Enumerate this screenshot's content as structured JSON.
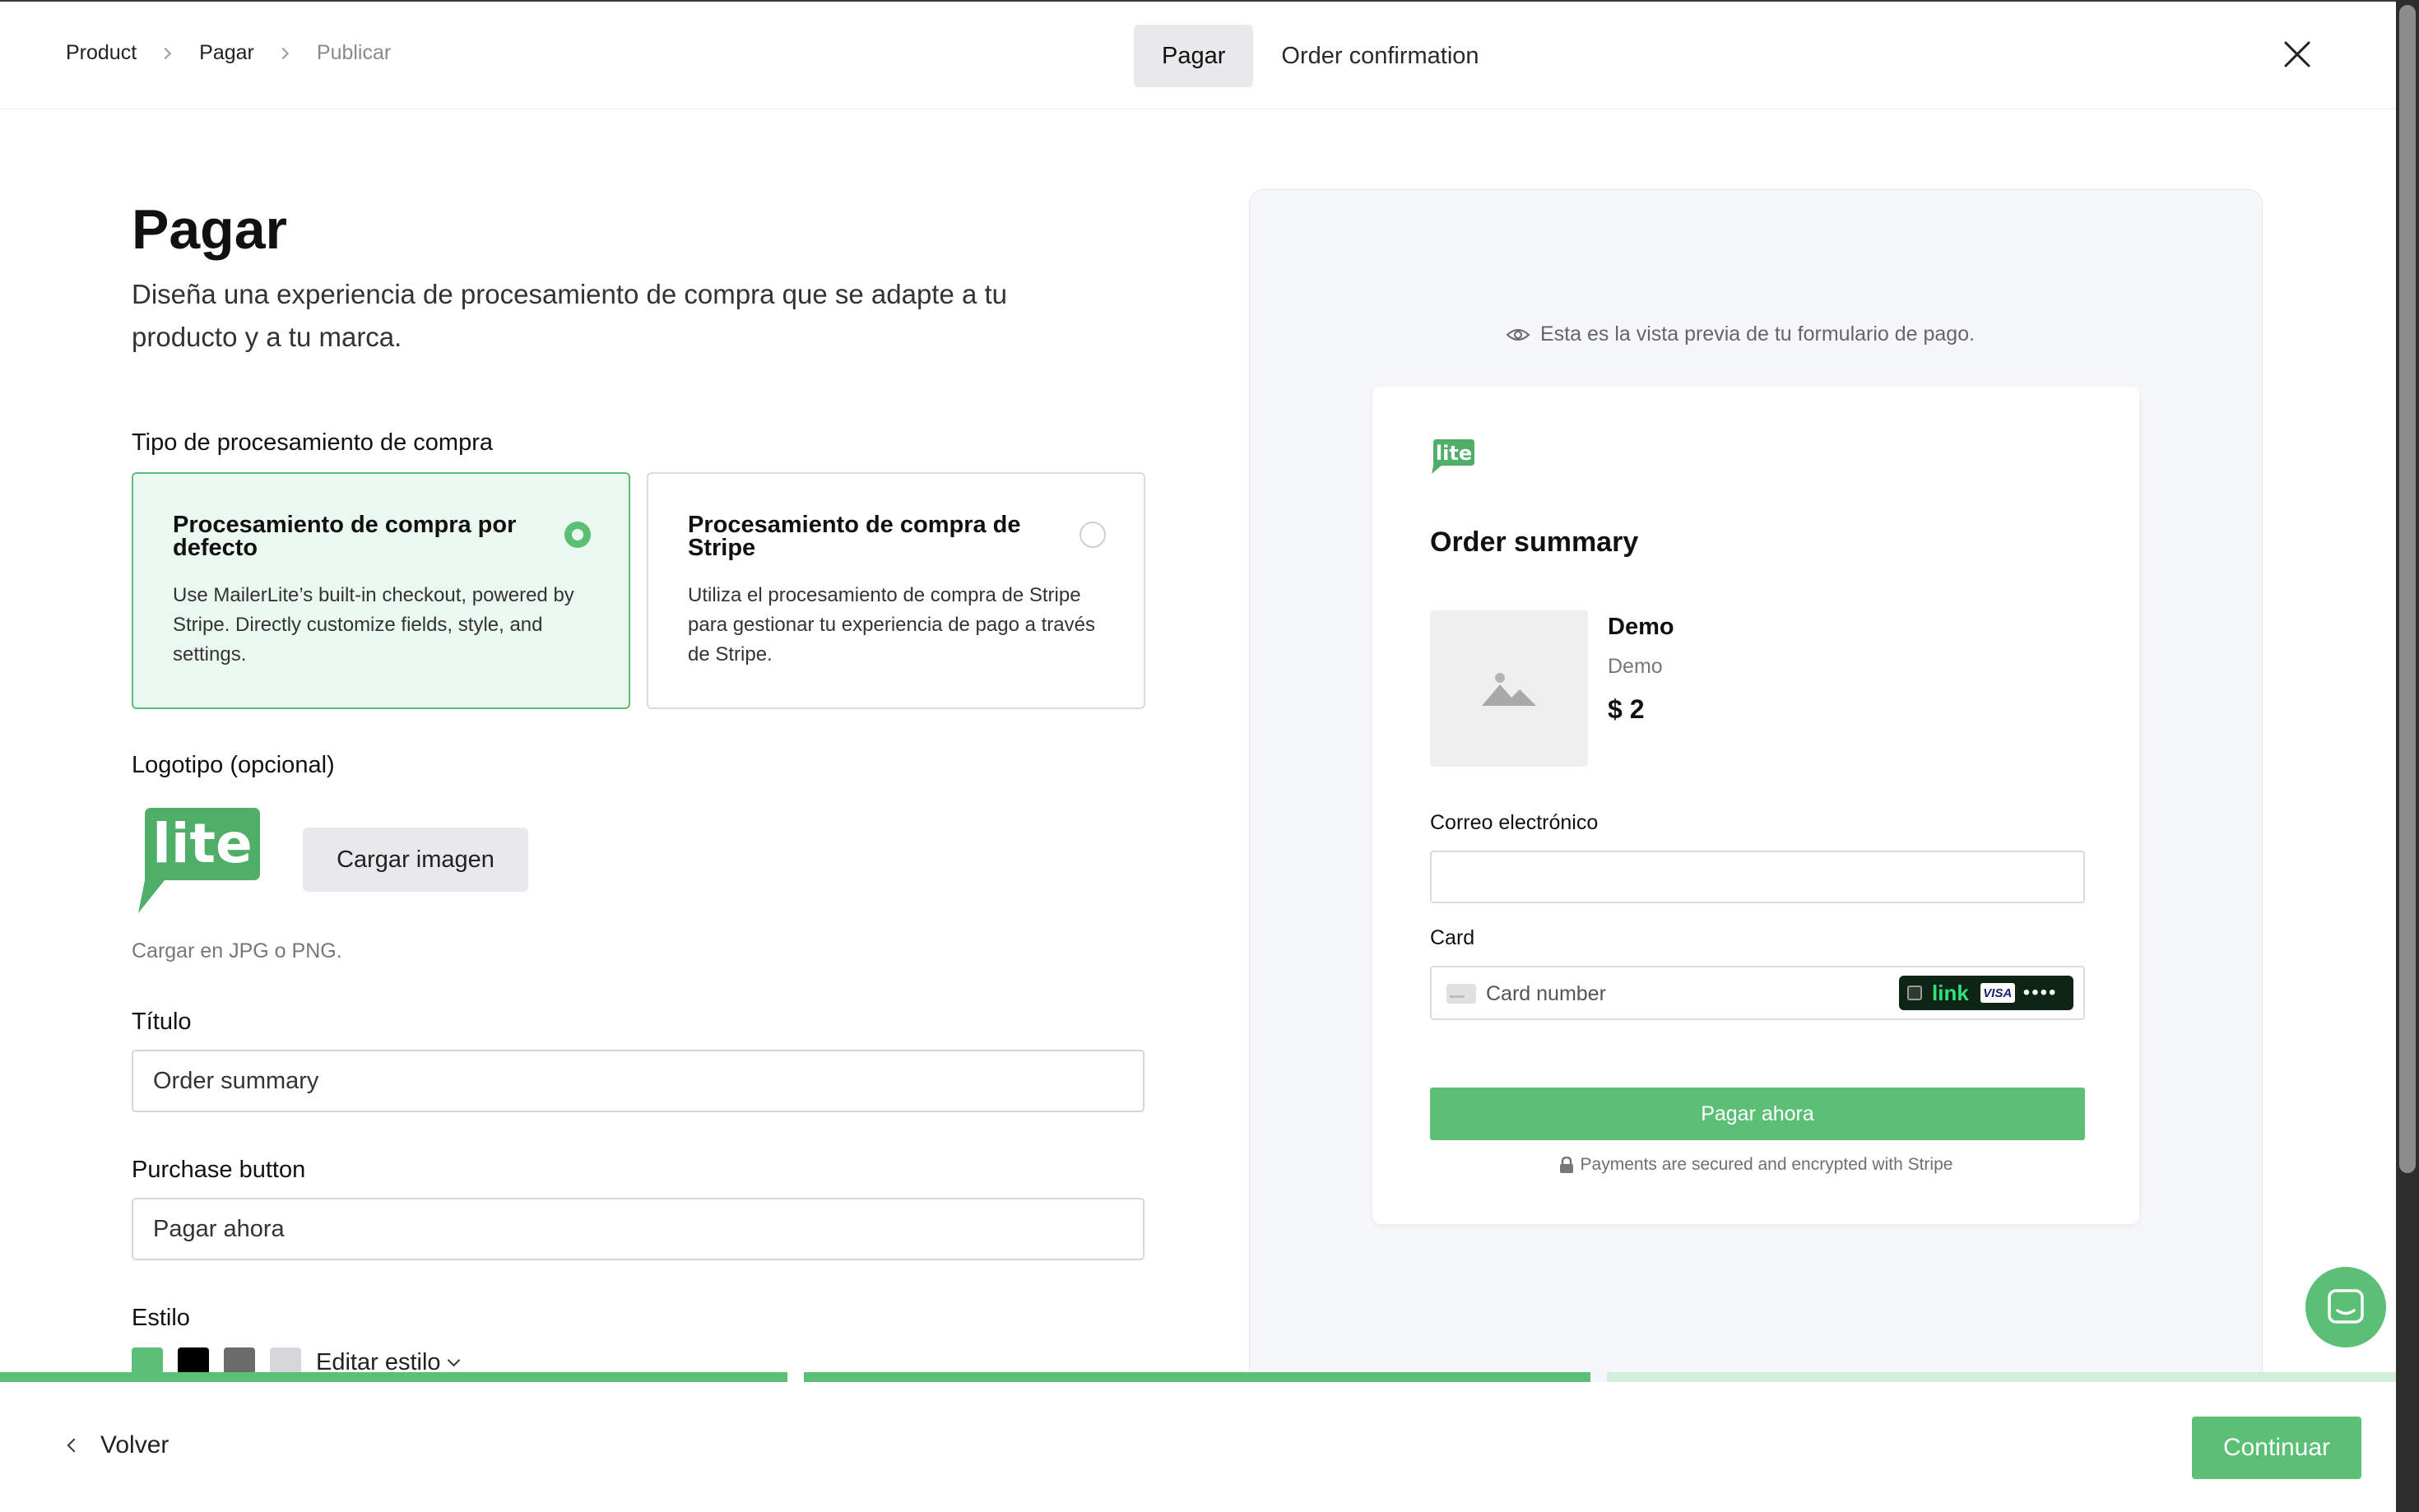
{
  "header": {
    "breadcrumb": [
      "Product",
      "Pagar",
      "Publicar"
    ],
    "tabs": [
      {
        "label": "Pagar",
        "active": true
      },
      {
        "label": "Order confirmation",
        "active": false
      }
    ]
  },
  "form": {
    "title": "Pagar",
    "subtitle": "Diseña una experiencia de procesamiento de compra que se adapte a tu producto y a tu marca.",
    "checkout_type": {
      "label": "Tipo de procesamiento de compra",
      "options": [
        {
          "title": "Procesamiento de compra por defecto",
          "description": "Use MailerLite’s built-in checkout, powered by Stripe. Directly customize fields, style, and settings.",
          "selected": true
        },
        {
          "title": "Procesamiento de compra de Stripe",
          "description": "Utiliza el procesamiento de compra de Stripe para gestionar tu experiencia de pago a través de Stripe.",
          "selected": false
        }
      ]
    },
    "logo": {
      "label": "Logotipo (opcional)",
      "logo_text": "lite",
      "upload_label": "Cargar imagen",
      "hint": "Cargar en JPG o PNG."
    },
    "title_field": {
      "label": "Título",
      "value": "Order summary"
    },
    "purchase_button_field": {
      "label": "Purchase button",
      "value": "Pagar ahora"
    },
    "style": {
      "label": "Estilo",
      "swatches": [
        "#5bbf76",
        "#000000",
        "#6b6b6b",
        "#d6d7da"
      ],
      "edit_label": "Editar estilo"
    }
  },
  "preview": {
    "note": "Esta es la vista previa de tu formulario de pago.",
    "logo_text": "lite",
    "title": "Order summary",
    "product": {
      "name": "Demo",
      "description": "Demo",
      "price": "$ 2"
    },
    "email_label": "Correo electrónico",
    "card_label": "Card",
    "card_placeholder": "Card number",
    "link_label": "link",
    "visa_label": "VISA",
    "dots": "••••",
    "pay_button": "Pagar ahora",
    "secure_note": "Payments are secured and encrypted with Stripe"
  },
  "progress": {
    "steps_completed": 2,
    "steps_total": 3
  },
  "footer": {
    "back_label": "Volver",
    "continue_label": "Continuar"
  },
  "colors": {
    "accent": "#5bbf76",
    "accent_light": "#ebf8ef",
    "progress_pending": "#d3efdb"
  }
}
